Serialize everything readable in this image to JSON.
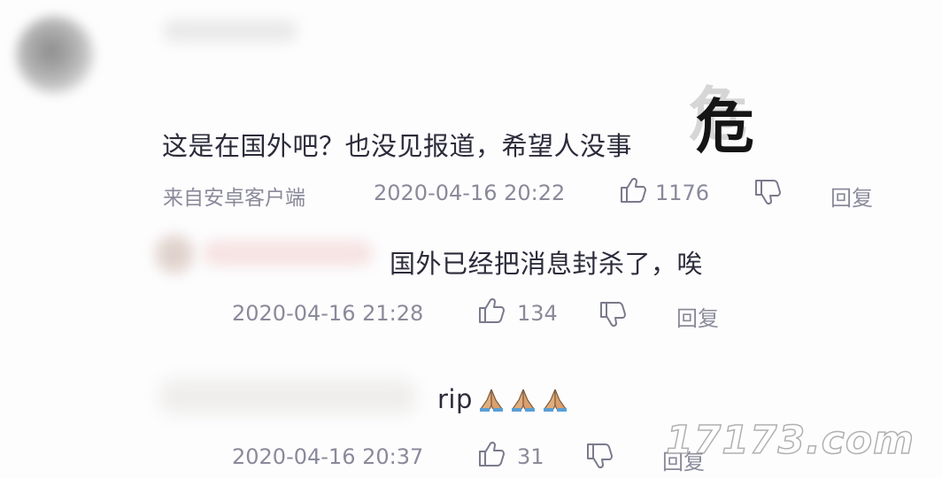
{
  "comments": {
    "main": {
      "text": "这是在国外吧？也没见报道，希望人没事",
      "emoji": "危",
      "source": "来自安卓客户端",
      "time": "2020-04-16 20:22",
      "likes": "1176",
      "reply_label": "回复"
    },
    "replies": [
      {
        "text": "国外已经把消息封杀了，唉",
        "time": "2020-04-16 21:28",
        "likes": "134",
        "reply_label": "回复"
      },
      {
        "text": "rip",
        "emoji_count": 3,
        "emoji_name": "folded-hands-icon",
        "time": "2020-04-16 20:37",
        "likes": "31",
        "reply_label": "回复"
      }
    ]
  },
  "watermark": "17173.com",
  "colors": {
    "text": "#2b2b3a",
    "meta": "#8a8a9a",
    "icon": "#7a7a8c"
  }
}
